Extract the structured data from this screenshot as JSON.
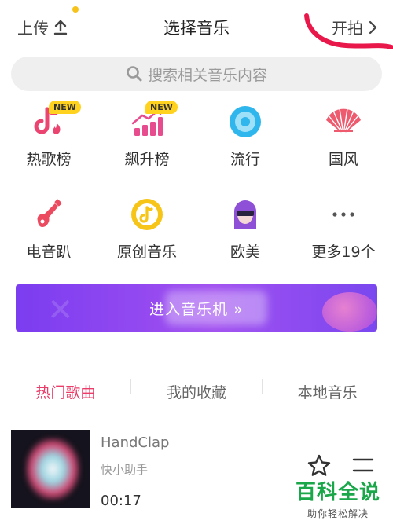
{
  "header": {
    "upload_label": "上传",
    "title": "选择音乐",
    "start_label": "开拍"
  },
  "search": {
    "placeholder": "搜索相关音乐内容"
  },
  "categories": [
    {
      "label": "热歌榜",
      "icon": "hot-songs-icon",
      "badge": "NEW"
    },
    {
      "label": "飙升榜",
      "icon": "rising-chart-icon",
      "badge": "NEW"
    },
    {
      "label": "流行",
      "icon": "pop-disc-icon"
    },
    {
      "label": "国风",
      "icon": "fan-icon"
    },
    {
      "label": "电音趴",
      "icon": "electric-guitar-icon"
    },
    {
      "label": "原创音乐",
      "icon": "original-music-icon"
    },
    {
      "label": "欧美",
      "icon": "western-avatar-icon"
    },
    {
      "label": "更多19个",
      "icon": "more-dots-icon"
    }
  ],
  "banner": {
    "text": "进入音乐机 »"
  },
  "tabs": [
    {
      "label": "热门歌曲",
      "active": true
    },
    {
      "label": "我的收藏",
      "active": false
    },
    {
      "label": "本地音乐",
      "active": false
    }
  ],
  "song": {
    "name": "HandClap",
    "artist": "快小助手",
    "duration": "00:17"
  },
  "watermark": {
    "title": "百科全说",
    "subtitle": "助你轻松解决"
  },
  "colors": {
    "accent": "#ea3d6a",
    "badge": "#ffd21f",
    "banner_start": "#7b3df0",
    "banner_end": "#a150f0",
    "watermark_green": "#1aa74a"
  }
}
